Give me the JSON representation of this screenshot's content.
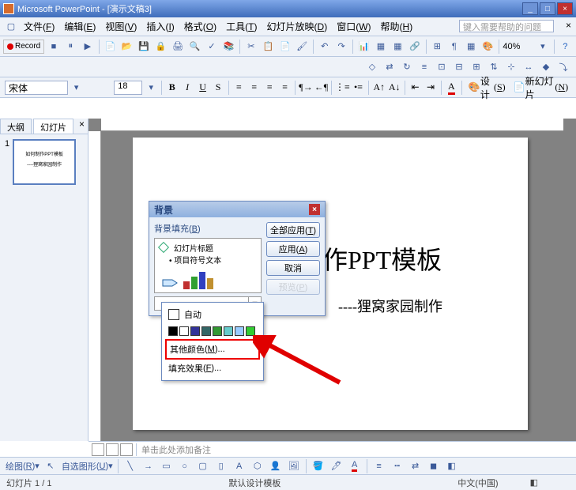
{
  "titlebar": {
    "title": "Microsoft PowerPoint - [演示文稿3]"
  },
  "menubar": {
    "file": "文件",
    "file_k": "F",
    "edit": "编辑",
    "edit_k": "E",
    "view": "视图",
    "view_k": "V",
    "insert": "插入",
    "insert_k": "I",
    "format": "格式",
    "format_k": "O",
    "tools": "工具",
    "tools_k": "T",
    "slideshow": "幻灯片放映",
    "slideshow_k": "D",
    "window": "窗口",
    "window_k": "W",
    "help": "帮助",
    "help_k": "H",
    "helpbox": "键入需要帮助的问题"
  },
  "toolbar": {
    "record": "Record",
    "zoom": "40%"
  },
  "format": {
    "font": "宋体",
    "size": "18",
    "design": "设计",
    "design_k": "S",
    "newslide": "新幻灯片",
    "newslide_k": "N"
  },
  "tabs": {
    "outline": "大纲",
    "slides": "幻灯片"
  },
  "thumb": {
    "num": "1",
    "title": "如何制作PPT模板",
    "sub": "----狸窝家园制作"
  },
  "slide": {
    "title_partial": "作PPT模板",
    "subtitle": "----狸窝家园制作"
  },
  "bgdialog": {
    "title": "背景",
    "fill_label": "背景填充",
    "fill_label_k": "B",
    "preview_title": "幻灯片标题",
    "preview_bullet": "项目符号文本",
    "apply_all": "全部应用",
    "apply_all_k": "T",
    "apply": "应用",
    "apply_k": "A",
    "cancel": "取消",
    "preview_btn": "预览",
    "preview_btn_k": "P"
  },
  "colorpopup": {
    "auto": "自动",
    "more": "其他颜色",
    "more_k": "M",
    "fill": "填充效果",
    "fill_k": "F",
    "swatch_colors": [
      "#000000",
      "#ffffff",
      "#333399",
      "#336666",
      "#339933",
      "#66cccc",
      "#99ccff",
      "#33cc33"
    ]
  },
  "notes": {
    "placeholder": "单击此处添加备注"
  },
  "drawbar": {
    "draw": "绘图",
    "draw_k": "R",
    "autoshapes": "自选图形",
    "autoshapes_k": "U"
  },
  "status": {
    "slide": "幻灯片 1 / 1",
    "template": "默认设计模板",
    "lang": "中文(中国)"
  }
}
